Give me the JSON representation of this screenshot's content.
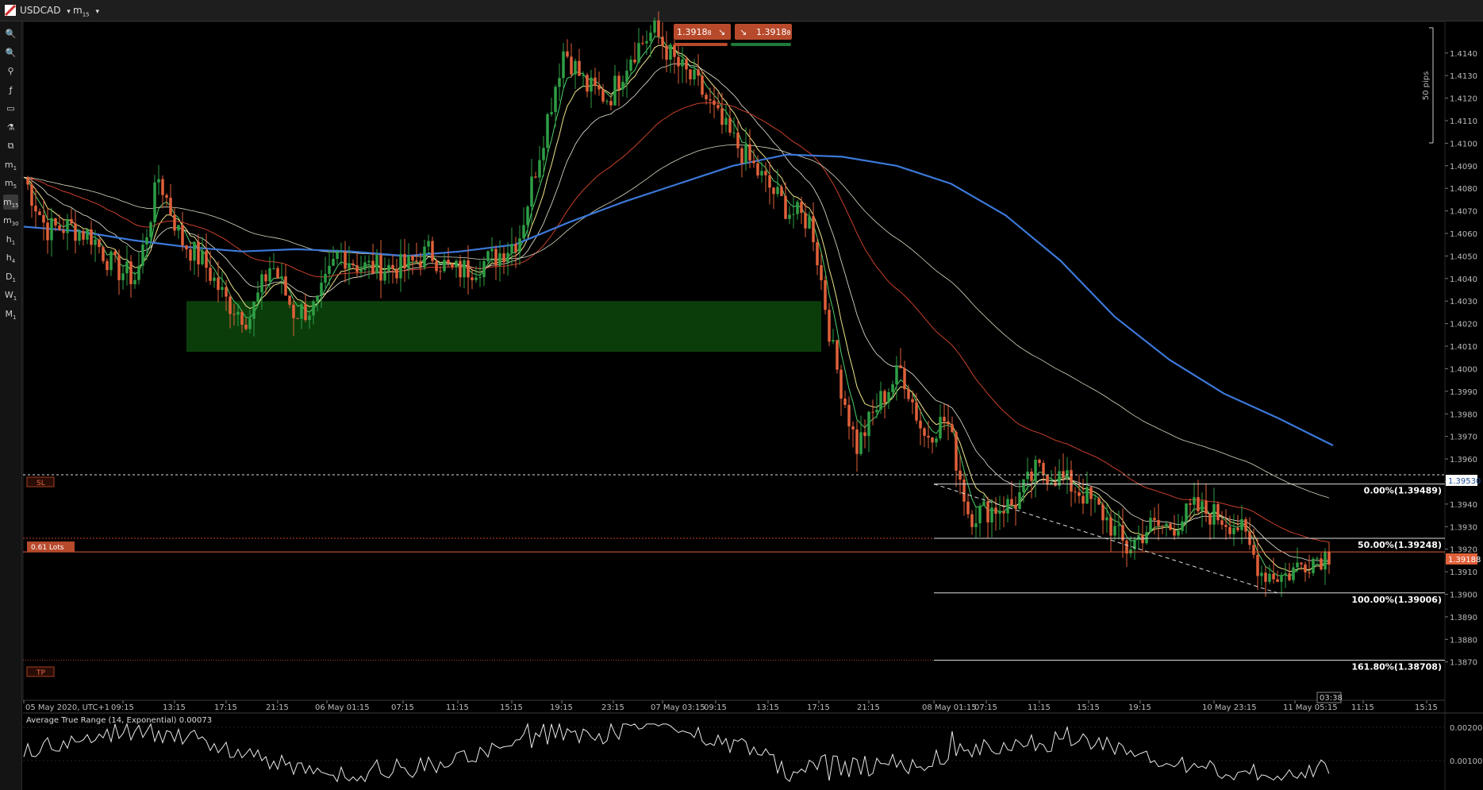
{
  "toolbar": {
    "symbol": "USDCAD",
    "symbol_arrow": "▾",
    "timeframe": "m",
    "timeframe_sub": "15",
    "timeframe_arrow": "▾"
  },
  "left_tools": [
    {
      "label": "🔍",
      "sub": ""
    },
    {
      "label": "🔍",
      "sub": ""
    },
    {
      "label": "⚲",
      "sub": ""
    },
    {
      "label": "ƒ",
      "sub": ""
    },
    {
      "label": "▭",
      "sub": ""
    },
    {
      "label": "⚗",
      "sub": ""
    },
    {
      "label": "⧉",
      "sub": ""
    },
    {
      "label": "m",
      "sub": "1"
    },
    {
      "label": "m",
      "sub": "5"
    },
    {
      "label": "m",
      "sub": "15"
    },
    {
      "label": "m",
      "sub": "30"
    },
    {
      "label": "h",
      "sub": "1"
    },
    {
      "label": "h",
      "sub": "4"
    },
    {
      "label": "D",
      "sub": "1"
    },
    {
      "label": "W",
      "sub": "1"
    },
    {
      "label": "M",
      "sub": "1"
    }
  ],
  "trade": {
    "sell_price": "1.3918",
    "sell_sup": "8",
    "buy_price": "1.3918",
    "buy_sup": "8"
  },
  "ruler": {
    "label": "50 pips"
  },
  "orders": {
    "sl_label": "SL",
    "lots_label": "0.61 Lots",
    "tp_label": "TP"
  },
  "price_tags": {
    "sl": "1.39530",
    "current": "1.39188"
  },
  "fib": {
    "f0": "0.00%(1.39489)",
    "f50": "50.00%(1.39248)",
    "f100": "100.00%(1.39006)",
    "f161": "161.80%(1.38708)"
  },
  "countdown": "03:38",
  "indicator": {
    "title": "Average True Range (14, Exponential) 0.00073"
  },
  "colors": {
    "bull": "#2e9e45",
    "bear": "#e0603a",
    "ma200": "#3c78d8",
    "ma50": "#c8402a",
    "demand_zone": "#0b3d0b"
  },
  "chart_data": {
    "type": "candlestick",
    "symbol": "USDCAD",
    "ylim": [
      1.3853,
      1.4154
    ],
    "price_ticks": [
      "1.4140",
      "1.4130",
      "1.4120",
      "1.4110",
      "1.4100",
      "1.4090",
      "1.4080",
      "1.4070",
      "1.4060",
      "1.4050",
      "1.4040",
      "1.4030",
      "1.4020",
      "1.4010",
      "1.4000",
      "1.3990",
      "1.3980",
      "1.3970",
      "1.3960",
      "1.3950",
      "1.3940",
      "1.3930",
      "1.3920",
      "1.3910",
      "1.3900",
      "1.3890",
      "1.3880",
      "1.3870"
    ],
    "time_labels": [
      "05 May 2020, UTC+1",
      "09:15",
      "13:15",
      "17:15",
      "21:15",
      "06 May 01:15",
      "07:15",
      "11:15",
      "15:15",
      "19:15",
      "23:15",
      "07 May 03:15",
      "09:15",
      "13:15",
      "17:15",
      "21:15",
      "08 May 01:15",
      "07:15",
      "11:15",
      "15:15",
      "19:15",
      "10 May 23:15",
      "11 May 05:15",
      "11:15",
      "15:15"
    ],
    "price_path": [
      1.4085,
      1.4062,
      1.4063,
      1.4059,
      1.4045,
      1.404,
      1.4085,
      1.4057,
      1.4047,
      1.403,
      1.4022,
      1.4047,
      1.4025,
      1.4027,
      1.4052,
      1.4045,
      1.4045,
      1.4045,
      1.4052,
      1.4043,
      1.4045,
      1.405,
      1.4058,
      1.41,
      1.4142,
      1.4125,
      1.412,
      1.414,
      1.415,
      1.4135,
      1.4125,
      1.4108,
      1.4095,
      1.4082,
      1.407,
      1.4065,
      1.4005,
      1.3965,
      1.3985,
      1.4,
      1.397,
      1.3978,
      1.3935,
      1.3938,
      1.394,
      1.3955,
      1.3952,
      1.3945,
      1.3935,
      1.392,
      1.393,
      1.393,
      1.3938,
      1.3935,
      1.393,
      1.391,
      1.3908,
      1.3915,
      1.3918
    ],
    "levels": {
      "sl": 1.3953,
      "entry": 1.39248,
      "current": 1.39188,
      "tp": 1.38708,
      "demand_top": 1.403,
      "demand_bottom": 1.40075
    },
    "fibonacci": [
      {
        "level": "0.00%",
        "price": 1.39489
      },
      {
        "level": "50.00%",
        "price": 1.39248
      },
      {
        "level": "100.00%",
        "price": 1.39006
      },
      {
        "level": "161.80%",
        "price": 1.38708
      }
    ],
    "ma200_path": [
      1.4063,
      1.4061,
      1.4057,
      1.4054,
      1.4052,
      1.4053,
      1.4052,
      1.405,
      1.4052,
      1.4055,
      1.4065,
      1.4074,
      1.4082,
      1.409,
      1.4095,
      1.4094,
      1.409,
      1.4082,
      1.4068,
      1.4048,
      1.4023,
      1.4004,
      1.3989,
      1.3978,
      1.3966
    ],
    "indicator_ticks": [
      "0.00200",
      "0.00100"
    ]
  }
}
